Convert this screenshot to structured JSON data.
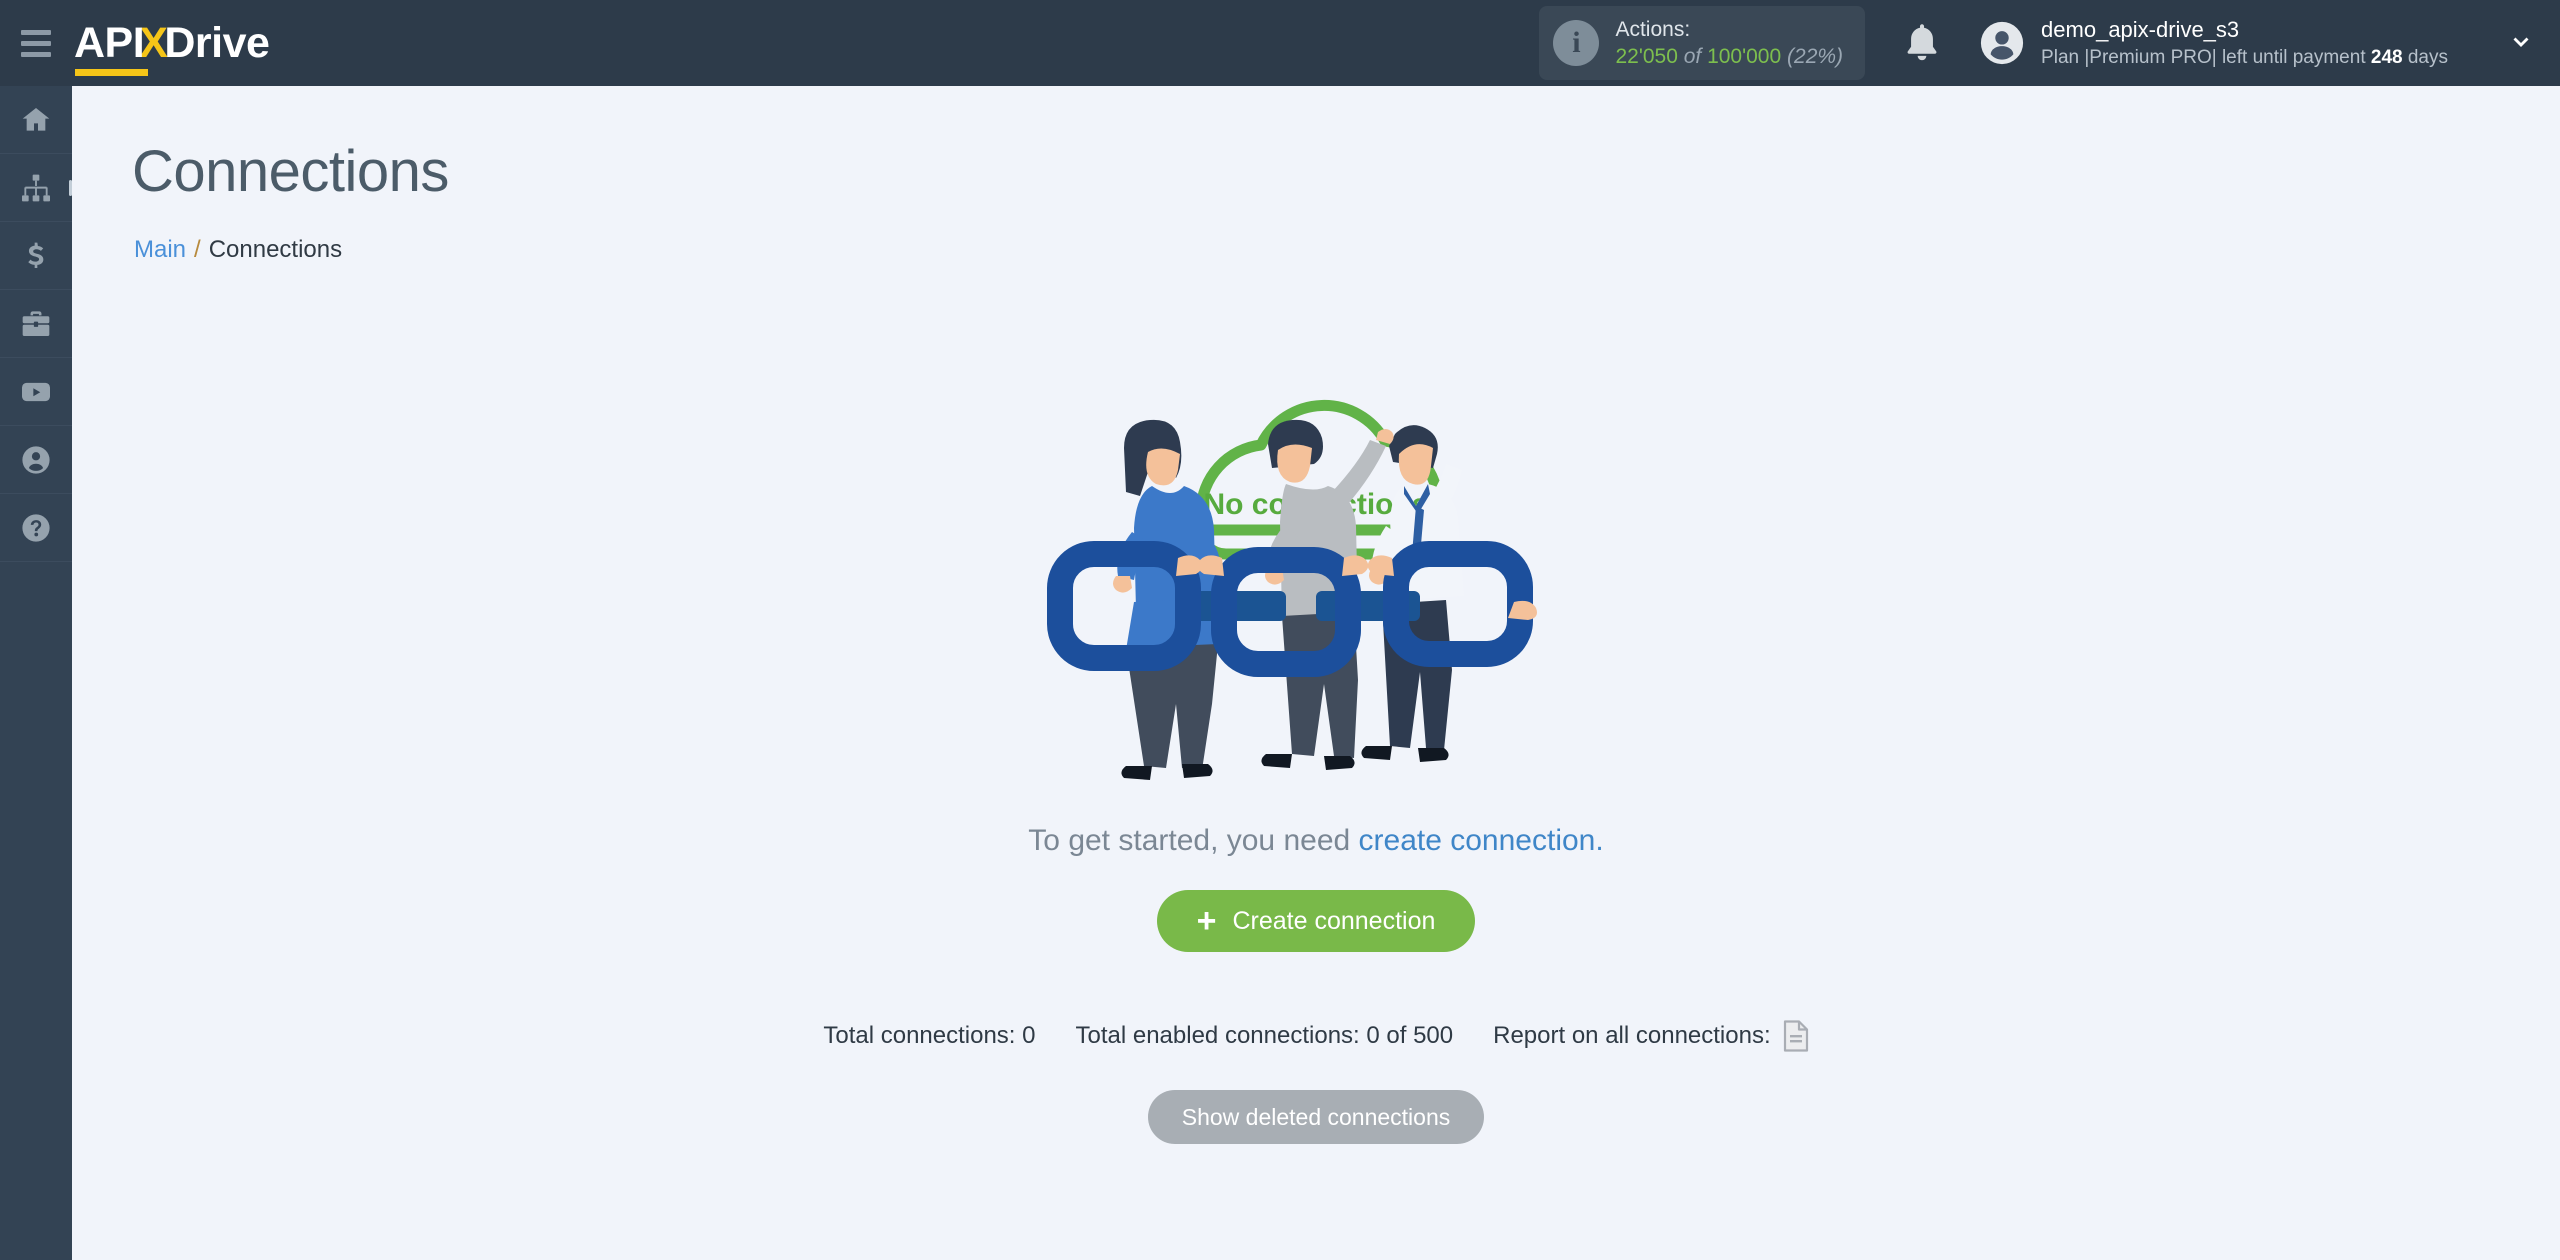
{
  "header": {
    "menu_icon": "hamburger-icon",
    "logo": {
      "part1": "API",
      "part2": "X",
      "part3": "Drive"
    },
    "actions": {
      "label": "Actions:",
      "used": "22'050",
      "of": "of",
      "total": "100'000",
      "percent": "(22%)",
      "info_icon": "info-icon"
    },
    "bell_icon": "bell-icon",
    "user": {
      "name": "demo_apix-drive_s3",
      "plan_prefix": "Plan |Premium PRO| left until payment ",
      "plan_days": "248",
      "plan_suffix": " days",
      "avatar_icon": "user-avatar-icon"
    },
    "chevron_icon": "chevron-down-icon"
  },
  "sidebar": {
    "items": [
      {
        "name": "home",
        "icon": "home-icon"
      },
      {
        "name": "connections",
        "icon": "sitemap-icon",
        "active": true
      },
      {
        "name": "billing",
        "icon": "dollar-icon"
      },
      {
        "name": "services",
        "icon": "briefcase-icon"
      },
      {
        "name": "video",
        "icon": "youtube-icon"
      },
      {
        "name": "account",
        "icon": "user-circle-icon"
      },
      {
        "name": "help",
        "icon": "question-circle-icon"
      }
    ]
  },
  "page": {
    "title": "Connections",
    "breadcrumb": {
      "root": "Main",
      "separator": "/",
      "current": "Connections"
    }
  },
  "empty_state": {
    "cloud_label": "No connections",
    "hint_text": "To get started, you need ",
    "hint_link": "create connection.",
    "create_button": {
      "plus": "+",
      "label": "Create connection"
    }
  },
  "stats": {
    "total_connections": "Total connections: 0",
    "total_enabled": "Total enabled connections: 0 of 500",
    "report_label": "Report on all connections:",
    "report_icon": "document-icon"
  },
  "footer": {
    "show_deleted": "Show deleted connections"
  },
  "colors": {
    "topbar_bg": "#2d3b4a",
    "sidebar_bg": "#334354",
    "page_bg": "#f1f4fa",
    "accent_green": "#79b949",
    "accent_yellow": "#f5c518",
    "link_blue": "#3f86c8",
    "gray_button": "#a8aeb4",
    "chain_blue": "#1f5aa5"
  }
}
